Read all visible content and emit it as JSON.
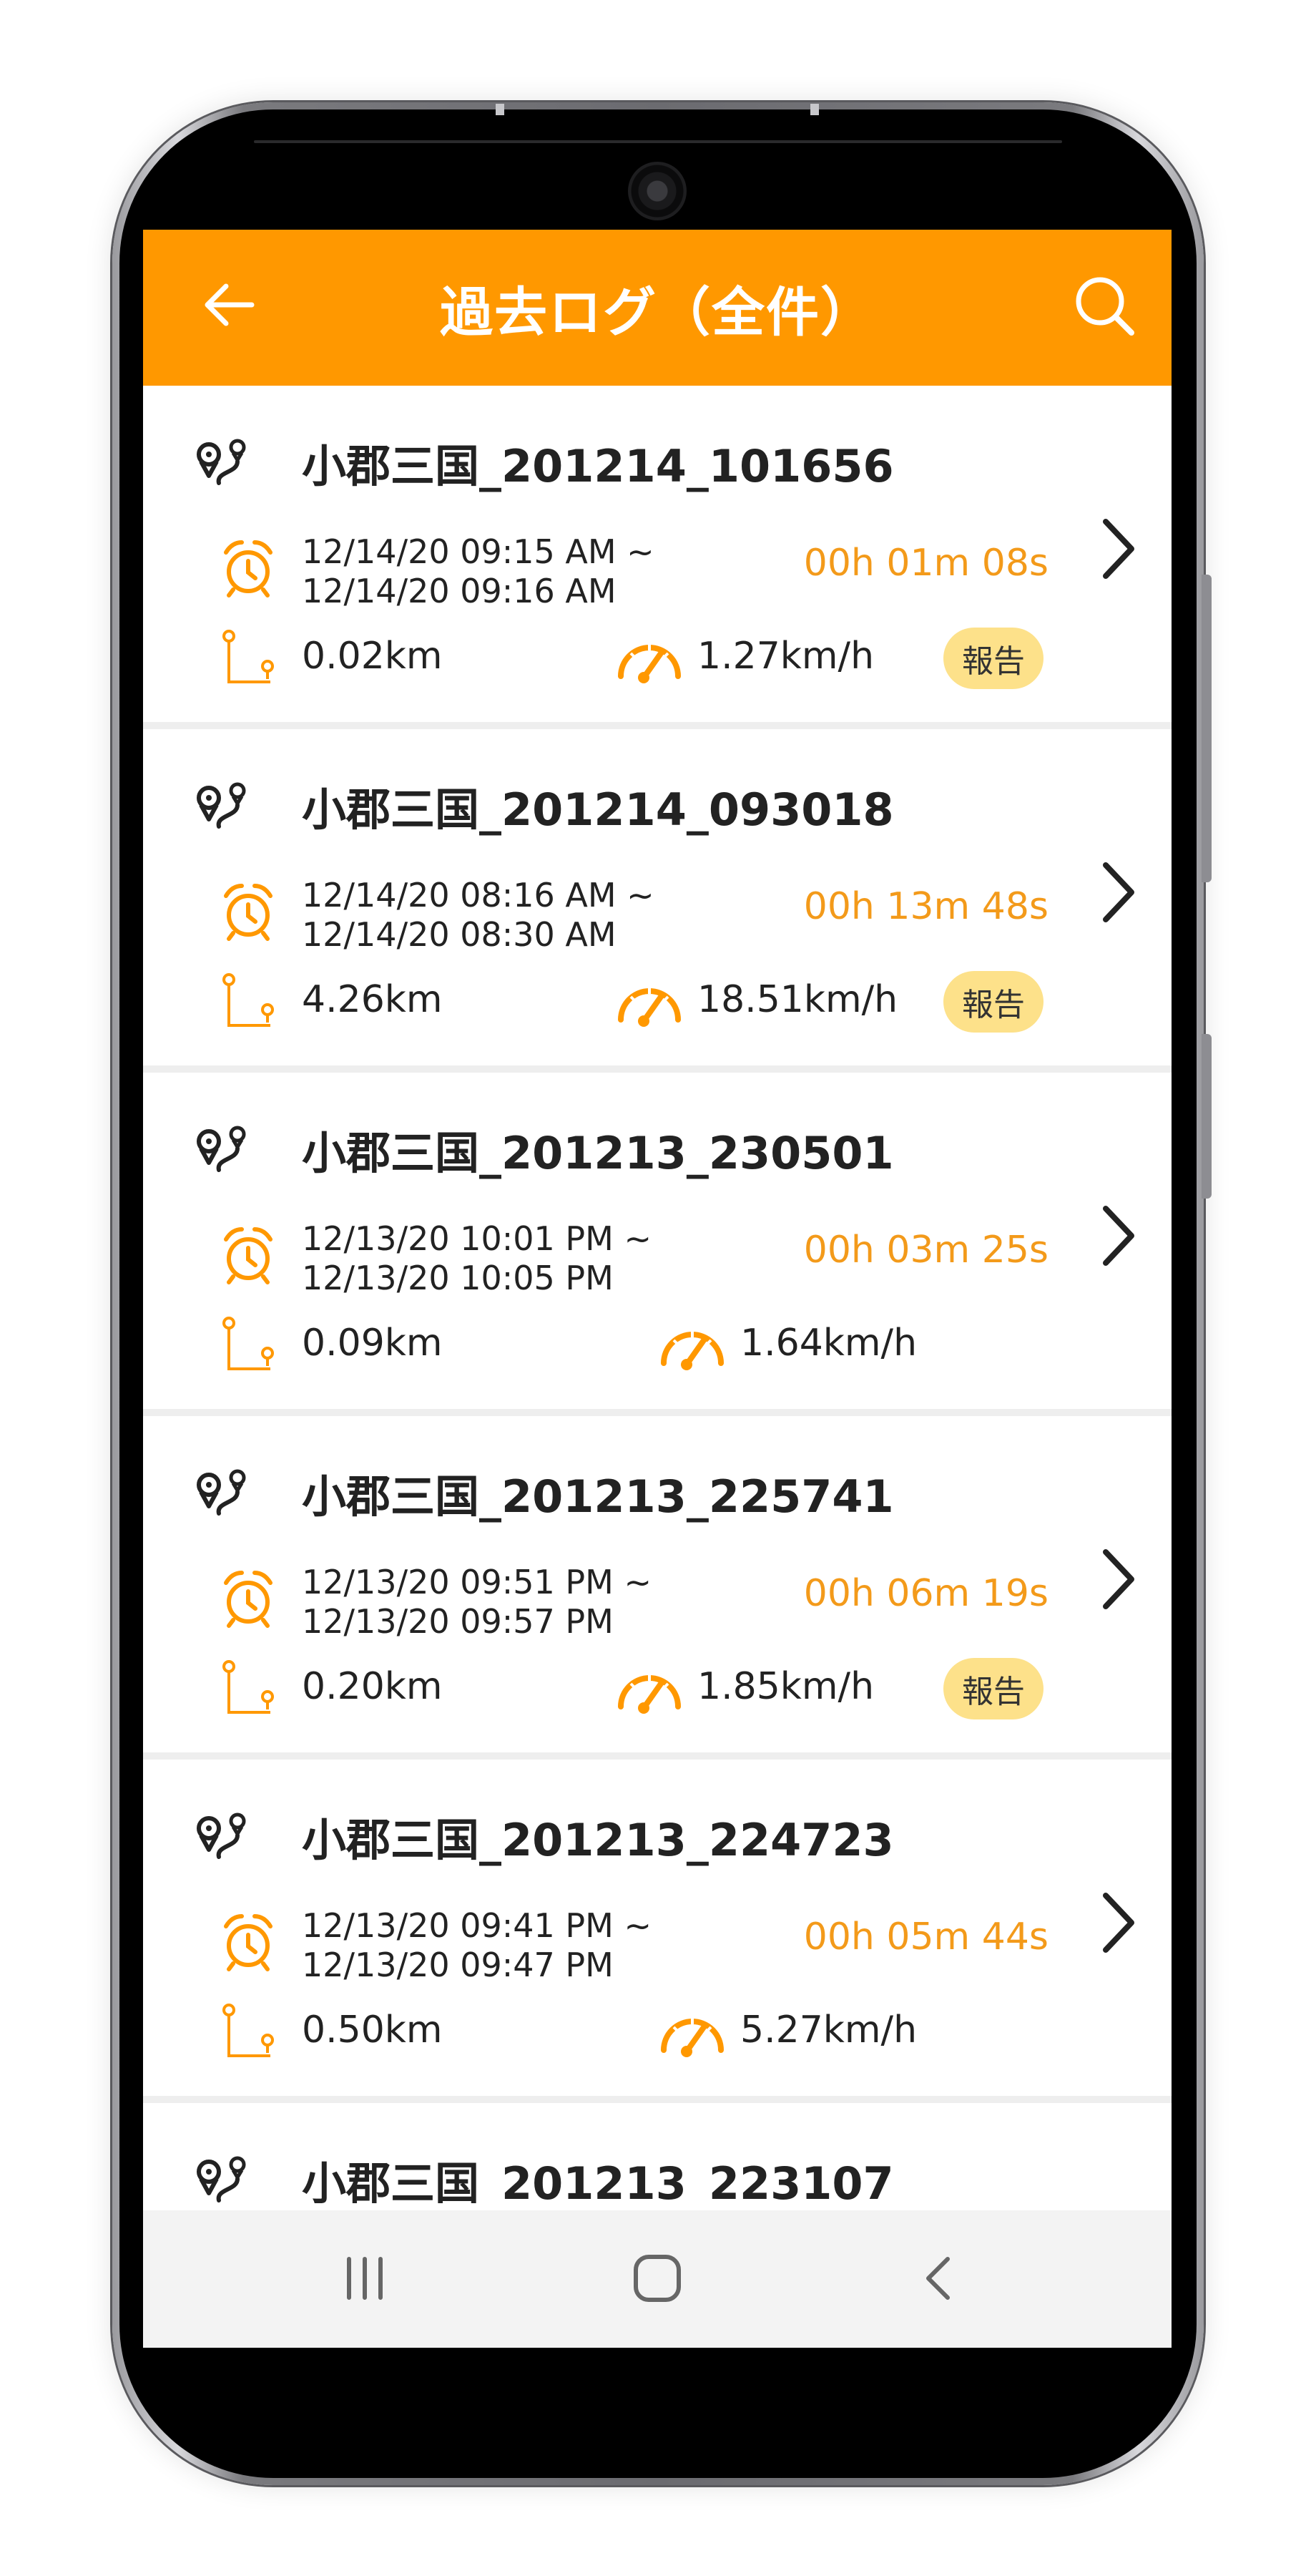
{
  "app_bar": {
    "title": "過去ログ（全件）",
    "back_icon": "arrow-left-icon",
    "search_icon": "search-icon",
    "color": "#ff9800"
  },
  "colors": {
    "accent": "#ff9800",
    "duration_text": "#f39a1a",
    "badge_bg": "#fde18a",
    "divider": "#eeeeee"
  },
  "logs": [
    {
      "name": "小郡三国_201214_101656",
      "start": "12/14/20 09:15 AM ~",
      "end": "12/14/20 09:16 AM",
      "duration": "00h 01m 08s",
      "distance": "0.02km",
      "speed": "1.27km/h",
      "report": "報告"
    },
    {
      "name": "小郡三国_201214_093018",
      "start": "12/14/20 08:16 AM ~",
      "end": "12/14/20 08:30 AM",
      "duration": "00h 13m 48s",
      "distance": "4.26km",
      "speed": "18.51km/h",
      "report": "報告"
    },
    {
      "name": "小郡三国_201213_230501",
      "start": "12/13/20 10:01 PM ~",
      "end": "12/13/20 10:05 PM",
      "duration": "00h 03m 25s",
      "distance": "0.09km",
      "speed": "1.64km/h",
      "report": ""
    },
    {
      "name": "小郡三国_201213_225741",
      "start": "12/13/20 09:51 PM ~",
      "end": "12/13/20 09:57 PM",
      "duration": "00h 06m 19s",
      "distance": "0.20km",
      "speed": "1.85km/h",
      "report": "報告"
    },
    {
      "name": "小郡三国_201213_224723",
      "start": "12/13/20 09:41 PM ~",
      "end": "12/13/20 09:47 PM",
      "duration": "00h 05m 44s",
      "distance": "0.50km",
      "speed": "5.27km/h",
      "report": ""
    },
    {
      "name": "小郡三国_201213_223107",
      "start": "",
      "end": "",
      "duration": "",
      "distance": "",
      "speed": "",
      "report": ""
    }
  ],
  "icons": {
    "route": "route-pin-icon",
    "clock": "alarm-clock-icon",
    "distance": "distance-path-icon",
    "speed": "speedometer-icon",
    "chevron": "chevron-right-icon"
  },
  "nav_bar": {
    "recent_icon": "recent-apps-icon",
    "home_icon": "home-icon",
    "back_icon": "back-icon"
  }
}
